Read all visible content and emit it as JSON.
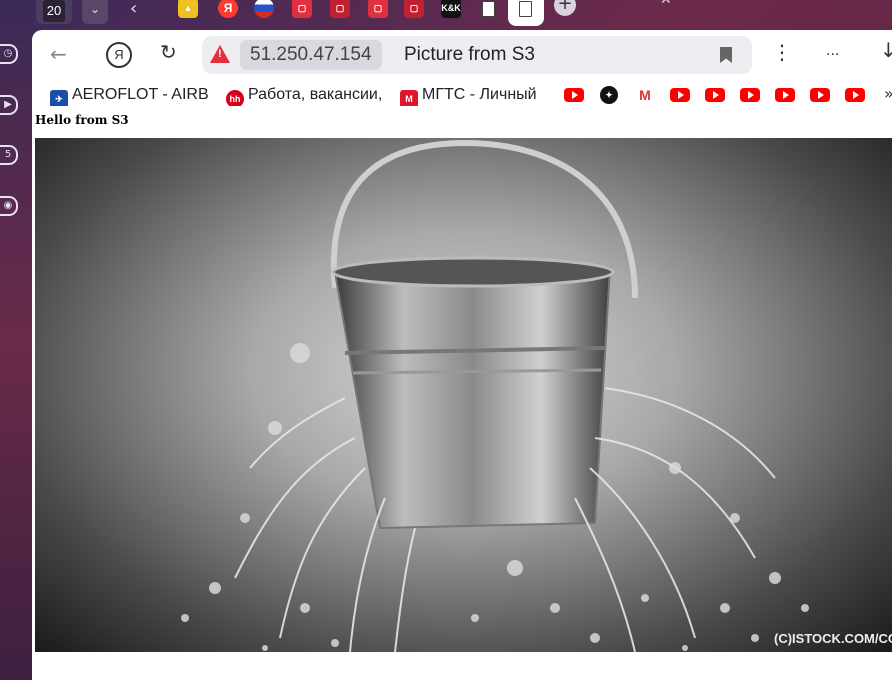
{
  "tabs": {
    "count": "20",
    "favicons": [
      {
        "name": "gallery",
        "color": "#f0c020",
        "glyph": ""
      },
      {
        "name": "yandex",
        "color": "#ff3b30",
        "glyph": "Я"
      },
      {
        "name": "russia-flag",
        "color": "#2255cc",
        "glyph": ""
      },
      {
        "name": "red-app-1",
        "color": "#e03040",
        "glyph": ""
      },
      {
        "name": "red-app-2",
        "color": "#c02030",
        "glyph": ""
      },
      {
        "name": "red-app-3",
        "color": "#e03040",
        "glyph": ""
      },
      {
        "name": "red-app-4",
        "color": "#c02030",
        "glyph": ""
      },
      {
        "name": "kk",
        "color": "#111111",
        "glyph": "K&K"
      }
    ]
  },
  "address_bar": {
    "host": "51.250.47.154",
    "title": "Picture from S3"
  },
  "toolbar": {
    "more_label": "..."
  },
  "bookmarks": [
    {
      "label": "AEROFLOT - AIRB",
      "icon": "aeroflot-icon",
      "color": "#1a4ea8",
      "glyph": "✈"
    },
    {
      "label": "Работа, вакансии,",
      "icon": "hh-icon",
      "color": "#d6001c",
      "glyph": "hh"
    },
    {
      "label": "МГТС - Личный",
      "icon": "mgts-icon",
      "color": "#e0142a",
      "glyph": "М"
    }
  ],
  "page": {
    "heading": "Hello from S3",
    "image_credit": "(C)ISTOCK.COM/CO"
  }
}
